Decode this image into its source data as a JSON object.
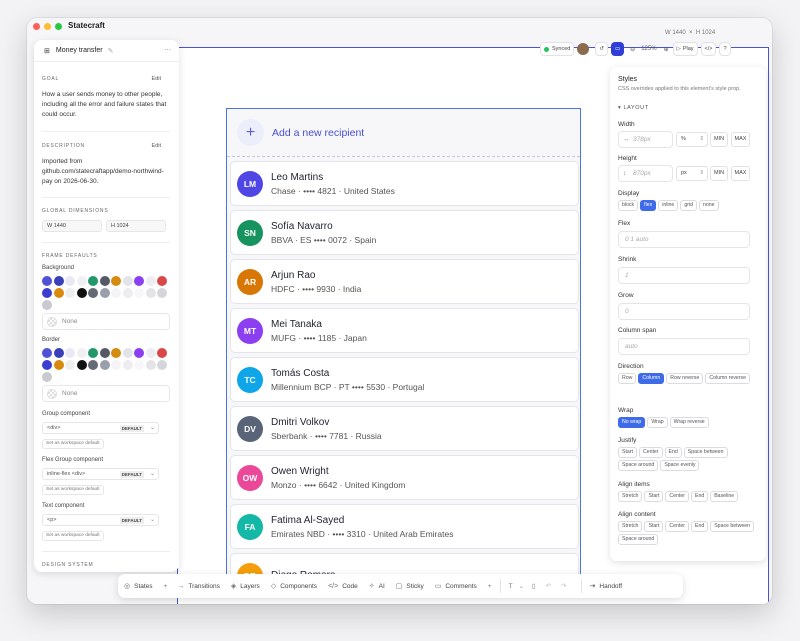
{
  "app": {
    "title": "Statecraft",
    "width_label": "W 1440",
    "height_label": "H 1024"
  },
  "left_panel": {
    "flow_title": "Money transfer",
    "goal_label": "GOAL",
    "edit": "Edit",
    "goal_text": "How a user sends money to other people, including all the error and failure states that could occur.",
    "description_label": "DESCRIPTION",
    "description_text": "Imported from github.com/statecraftapp/demo-northwind-pay on 2026-06-30.",
    "global_dimensions_label": "GLOBAL DIMENSIONS",
    "w_value": "W  1440",
    "h_value": "H  1024",
    "frame_defaults_label": "FRAME DEFAULTS",
    "background_label": "Background",
    "border_label": "Border",
    "none_label": "None",
    "group_component_label": "Group component",
    "group_component_value": "<div>",
    "flex_group_label": "Flex Group component",
    "flex_group_value": "inline-flex <div>",
    "text_component_label": "Text component",
    "text_component_value": "<p>",
    "default_badge": "DEFAULT",
    "workspace_default": "Set as workspace default",
    "design_system_label": "DESIGN SYSTEM",
    "swatch_colors": [
      "#4f52d6",
      "#3b3fb8",
      "#e9e9f6",
      "#f0f0f4",
      "#23976b",
      "#555a66",
      "#d58a10",
      "#e3e3ea",
      "#8b3ff0",
      "#ececf1",
      "#d94848",
      "#3a3fd0",
      "#d98a0c",
      "#eeeeee",
      "#111111",
      "#656a75",
      "#9aa0ab",
      "#f4f4f7",
      "#ededf1",
      "#f7f7fa",
      "#e4e4e8",
      "#d4d6dc",
      "#c8cad0"
    ]
  },
  "top_toolbar": {
    "synced": "Synced",
    "zoom": "125%",
    "play": "Play"
  },
  "list": {
    "add_label": "Add a new recipient",
    "recipients": [
      {
        "initials": "LM",
        "name": "Leo Martins",
        "detail": "Chase · •••• 4821 · United States",
        "color": "#4f46e5"
      },
      {
        "initials": "SN",
        "name": "Sofía Navarro",
        "detail": "BBVA · ES •••• 0072 · Spain",
        "color": "#16935f"
      },
      {
        "initials": "AR",
        "name": "Arjun Rao",
        "detail": "HDFC · •••• 9930 · India",
        "color": "#d97706"
      },
      {
        "initials": "MT",
        "name": "Mei Tanaka",
        "detail": "MUFG · •••• 1185 · Japan",
        "color": "#8b3ff0"
      },
      {
        "initials": "TC",
        "name": "Tomás Costa",
        "detail": "Millennium BCP · PT •••• 5530 · Portugal",
        "color": "#0ea5e9"
      },
      {
        "initials": "DV",
        "name": "Dmitri Volkov",
        "detail": "Sberbank · •••• 7781 · Russia",
        "color": "#5a6478"
      },
      {
        "initials": "OW",
        "name": "Owen Wright",
        "detail": "Monzo · •••• 6642 · United Kingdom",
        "color": "#ec4899"
      },
      {
        "initials": "FA",
        "name": "Fatima Al-Sayed",
        "detail": "Emirates NBD · •••• 3310 · United Arab Emirates",
        "color": "#14b8a6"
      },
      {
        "initials": "DR",
        "name": "Diego Romero",
        "detail": "",
        "color": "#f59e0b"
      }
    ]
  },
  "right_panel": {
    "title": "Styles",
    "subtitle": "CSS overrides applied to this element's style prop.",
    "layout_label": "▾ LAYOUT",
    "width_label": "Width",
    "width_placeholder": "378px",
    "unit_percent": "%",
    "unit_px": "px",
    "min": "MIN",
    "max": "MAX",
    "height_label": "Height",
    "height_placeholder": "870px",
    "display_label": "Display",
    "display_options": [
      "block",
      "flex",
      "inline",
      "grid",
      "none"
    ],
    "flex_label": "Flex",
    "flex_placeholder": "0 1 auto",
    "shrink_label": "Shrink",
    "shrink_placeholder": "1",
    "grow_label": "Grow",
    "grow_placeholder": "0",
    "column_span_label": "Column span",
    "column_span_placeholder": "auto",
    "direction_label": "Direction",
    "direction_options": [
      "Row",
      "Column",
      "Row reverse",
      "Column reverse"
    ],
    "wrap_label": "Wrap",
    "wrap_options": [
      "No wrap",
      "Wrap",
      "Wrap reverse"
    ],
    "justify_label": "Justify",
    "justify_options": [
      "Start",
      "Center",
      "End",
      "Space between",
      "Space around",
      "Space evenly"
    ],
    "align_items_label": "Align items",
    "align_items_options": [
      "Stretch",
      "Start",
      "Center",
      "End",
      "Baseline"
    ],
    "align_content_label": "Align content",
    "align_content_options": [
      "Stretch",
      "Start",
      "Center",
      "End",
      "Space between",
      "Space around"
    ]
  },
  "bottom_toolbar": {
    "states": "States",
    "transitions": "Transitions",
    "layers": "Layers",
    "components": "Components",
    "code": "Code",
    "ai": "AI",
    "sticky": "Sticky",
    "comments": "Comments",
    "handoff": "Handoff"
  }
}
